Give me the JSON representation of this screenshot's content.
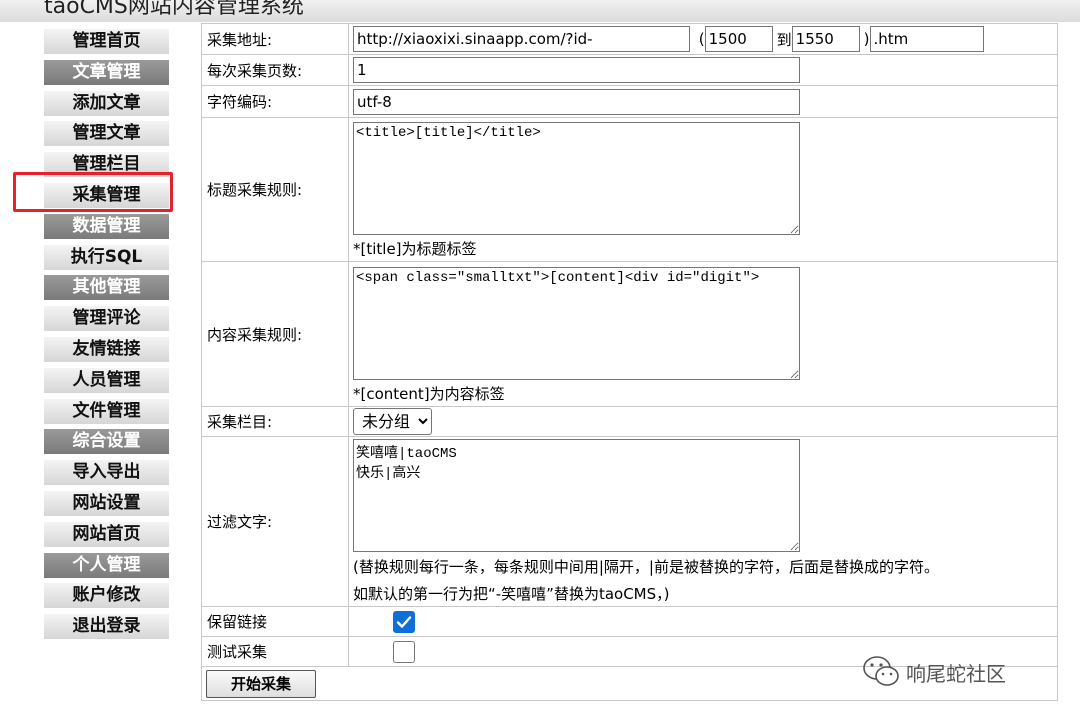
{
  "header": {
    "title": "taoCMS网站内容管理系统"
  },
  "sidebar": {
    "items": [
      {
        "label": "管理首页",
        "kind": "link"
      },
      {
        "label": "文章管理",
        "kind": "group"
      },
      {
        "label": "添加文章",
        "kind": "link"
      },
      {
        "label": "管理文章",
        "kind": "link"
      },
      {
        "label": "管理栏目",
        "kind": "link"
      },
      {
        "label": "采集管理",
        "kind": "link"
      },
      {
        "label": "数据管理",
        "kind": "group"
      },
      {
        "label": "执行SQL",
        "kind": "link"
      },
      {
        "label": "其他管理",
        "kind": "group"
      },
      {
        "label": "管理评论",
        "kind": "link"
      },
      {
        "label": "友情链接",
        "kind": "link"
      },
      {
        "label": "人员管理",
        "kind": "link"
      },
      {
        "label": "文件管理",
        "kind": "link"
      },
      {
        "label": "综合设置",
        "kind": "group"
      },
      {
        "label": "导入导出",
        "kind": "link"
      },
      {
        "label": "网站设置",
        "kind": "link"
      },
      {
        "label": "网站首页",
        "kind": "link"
      },
      {
        "label": "个人管理",
        "kind": "group"
      },
      {
        "label": "账户修改",
        "kind": "link"
      },
      {
        "label": "退出登录",
        "kind": "link"
      }
    ],
    "highlight_color": "#e8202a"
  },
  "form": {
    "url": {
      "label": "采集地址:",
      "value": "http://xiaoxixi.sinaapp.com/?id-",
      "open_paren": "(",
      "start": "1500",
      "to": "到",
      "end": "1550",
      "close_paren": ")",
      "suffix": ".htm"
    },
    "pages": {
      "label": "每次采集页数:",
      "value": "1"
    },
    "encoding": {
      "label": "字符编码:",
      "value": "utf-8"
    },
    "title_rule": {
      "label": "标题采集规则:",
      "value": "<title>[title]</title>",
      "note": "*[title]为标题标签"
    },
    "content_rule": {
      "label": "内容采集规则:",
      "value": "<span class=\"smalltxt\">[content]<div id=\"digit\">",
      "note": "*[content]为内容标签"
    },
    "category": {
      "label": "采集栏目:",
      "selected": "未分组"
    },
    "filter": {
      "label": "过滤文字:",
      "value": "笑嘻嘻|taoCMS\n快乐|高兴",
      "note1": "(替换规则每行一条，每条规则中间用|隔开，|前是被替换的字符，后面是替换成的字符。",
      "note2": "如默认的第一行为把“-笑嘻嘻”替换为taoCMS，)"
    },
    "keep_links": {
      "label": "保留链接",
      "checked": true
    },
    "test_collect": {
      "label": "测试采集",
      "checked": false
    },
    "submit_label": "开始采集"
  },
  "watermark": {
    "text": "响尾蛇社区",
    "icon": "wechat-icon"
  },
  "colors": {
    "accent": "#0f6fd8",
    "group_bg": "#8a8a8a"
  }
}
